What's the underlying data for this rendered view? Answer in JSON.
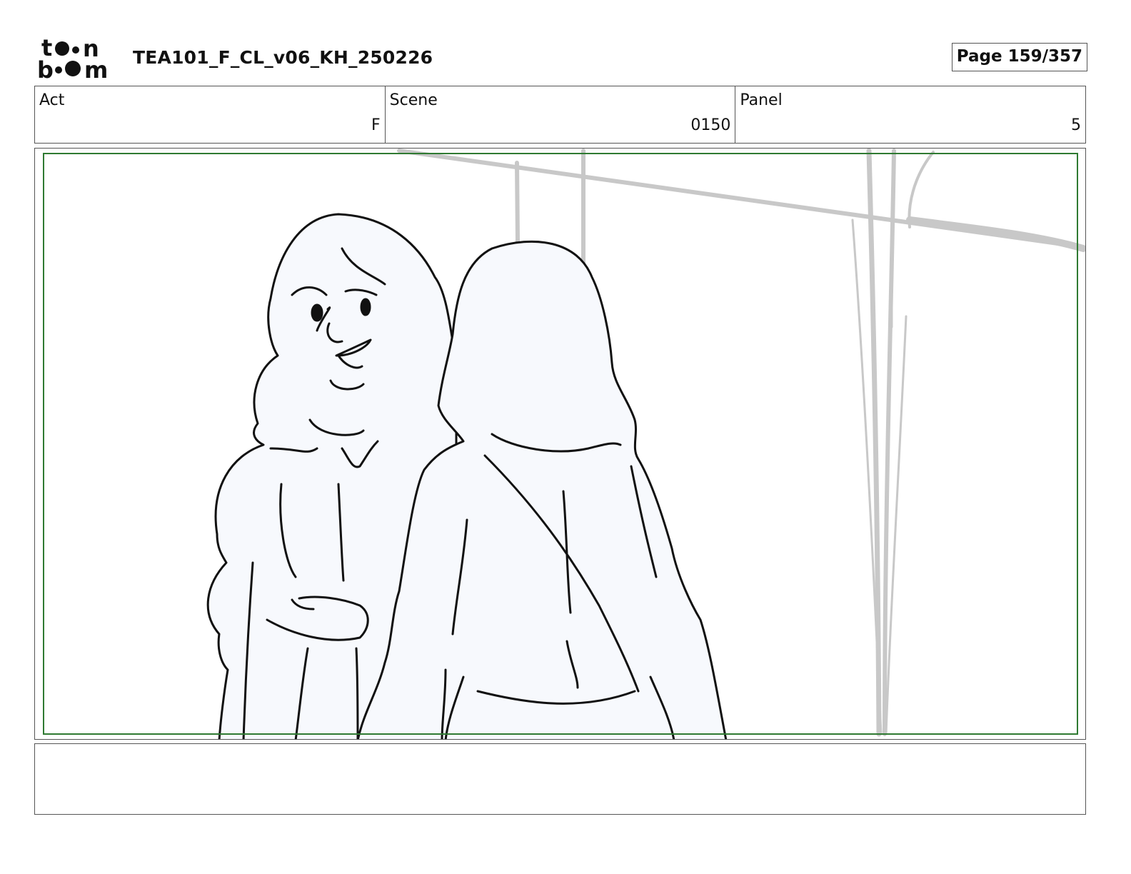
{
  "header": {
    "logo_alt": "toon boom",
    "title": "TEA101_F_CL_v06_KH_250226",
    "page_label": "Page 159/357"
  },
  "info": {
    "act": {
      "label": "Act",
      "value": "F"
    },
    "scene": {
      "label": "Scene",
      "value": "0150"
    },
    "panel": {
      "label": "Panel",
      "value": "5"
    }
  },
  "colors": {
    "safe_area": "#2f7a32",
    "sketch_line": "#111111",
    "background_sketch": "#c8c8c8",
    "figure_fill": "#f7f9fd"
  },
  "notes": {
    "text": ""
  }
}
